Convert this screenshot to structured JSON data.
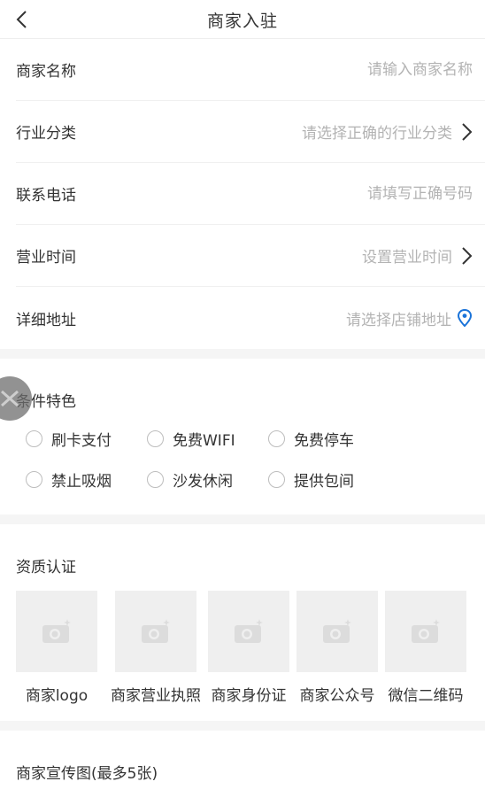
{
  "nav": {
    "title": "商家入驻"
  },
  "form": {
    "merchant_name": {
      "label": "商家名称",
      "placeholder": "请输入商家名称"
    },
    "industry": {
      "label": "行业分类",
      "placeholder": "请选择正确的行业分类"
    },
    "phone": {
      "label": "联系电话",
      "placeholder": "请填写正确号码"
    },
    "hours": {
      "label": "营业时间",
      "placeholder": "设置营业时间"
    },
    "address": {
      "label": "详细地址",
      "placeholder": "请选择店铺地址"
    }
  },
  "features": {
    "title": "条件特色",
    "items": [
      "刷卡支付",
      "免费WIFI",
      "免费停车",
      "禁止吸烟",
      "沙发休闲",
      "提供包间"
    ]
  },
  "qualification": {
    "title": "资质认证",
    "items": [
      "商家logo",
      "商家营业执照",
      "商家身份证",
      "商家公众号",
      "微信二维码"
    ]
  },
  "promo": {
    "title": "商家宣传图(最多5张)"
  },
  "colors": {
    "accent": "#4a90e2",
    "placeholder": "#b3b3b3",
    "divider": "#f5f5f5",
    "tile": "#efefef"
  },
  "icons": [
    "back-arrow-icon",
    "chevron-right-icon",
    "location-pin-icon",
    "camera-icon",
    "floating-assist-icon"
  ]
}
